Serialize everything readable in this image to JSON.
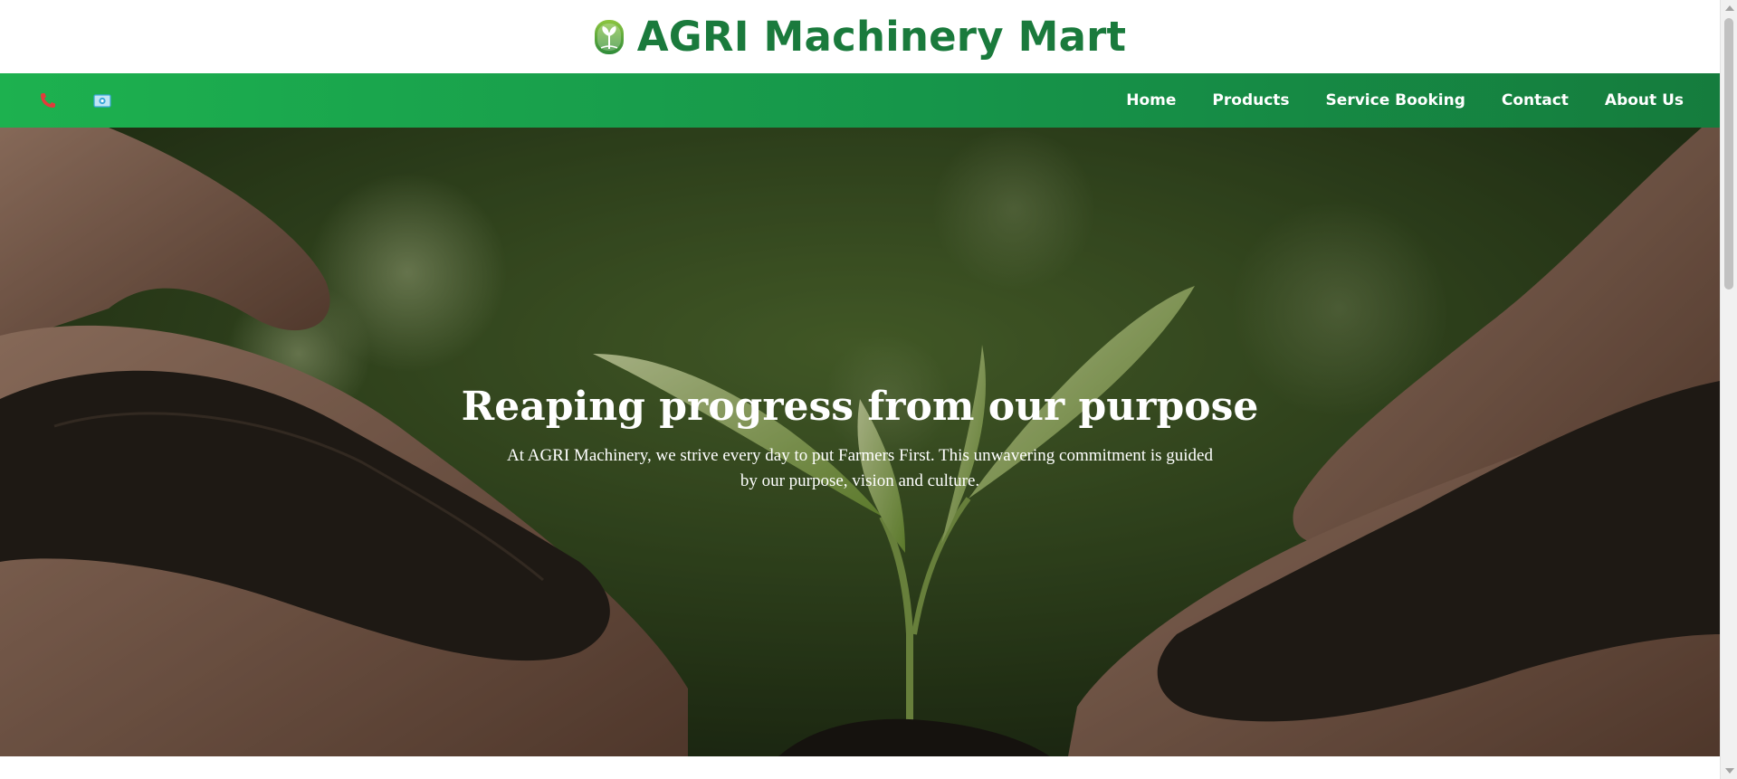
{
  "header": {
    "title": "AGRI Machinery Mart",
    "logo_icon": "tree-leaf-logo-icon"
  },
  "navbar": {
    "left_icons": [
      "phone-icon",
      "email-icon"
    ],
    "links": [
      {
        "label": "Home"
      },
      {
        "label": "Products"
      },
      {
        "label": "Service Booking"
      },
      {
        "label": "Contact"
      },
      {
        "label": "About Us"
      }
    ]
  },
  "hero": {
    "title": "Reaping progress from our purpose",
    "description": "At AGRI Machinery, we strive every day to put Farmers First. This unwavering commitment is guided by our purpose, vision and culture."
  },
  "colors": {
    "brand_green": "#1a7a3c",
    "nav_gradient_start": "#1db14f",
    "nav_gradient_end": "#157c3d",
    "phone_icon_red": "#e23b3b",
    "email_icon_blue": "#39a7d9"
  }
}
